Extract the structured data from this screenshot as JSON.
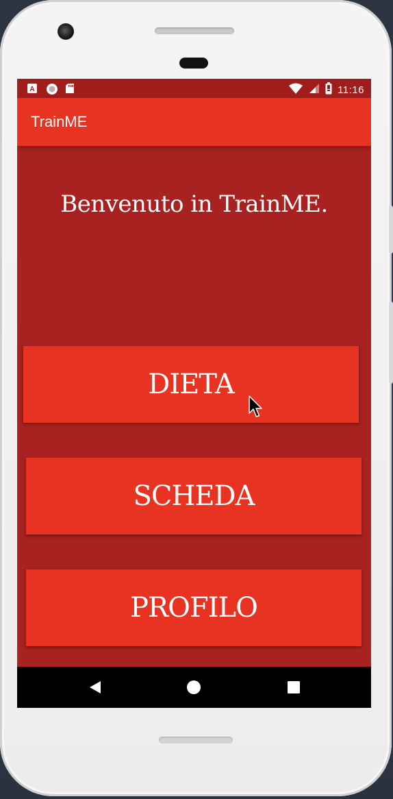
{
  "status_bar": {
    "time": "11:16",
    "left_icons": [
      "a-notification-icon",
      "record-icon",
      "sd-card-icon"
    ],
    "right_icons": [
      "wifi-icon",
      "signal-icon",
      "battery-icon"
    ]
  },
  "app_bar": {
    "title": "TrainME"
  },
  "main": {
    "welcome": "Benvenuto in TrainME.",
    "buttons": [
      {
        "label": "DIETA"
      },
      {
        "label": "SCHEDA"
      },
      {
        "label": "PROFILO"
      }
    ]
  },
  "nav_bar": {
    "icons": [
      "back-icon",
      "home-icon",
      "recents-icon"
    ]
  },
  "colors": {
    "status_bar": "#a01d1b",
    "app_bar": "#e83323",
    "background": "#a72220",
    "button": "#e83323",
    "text": "#ffffff"
  }
}
